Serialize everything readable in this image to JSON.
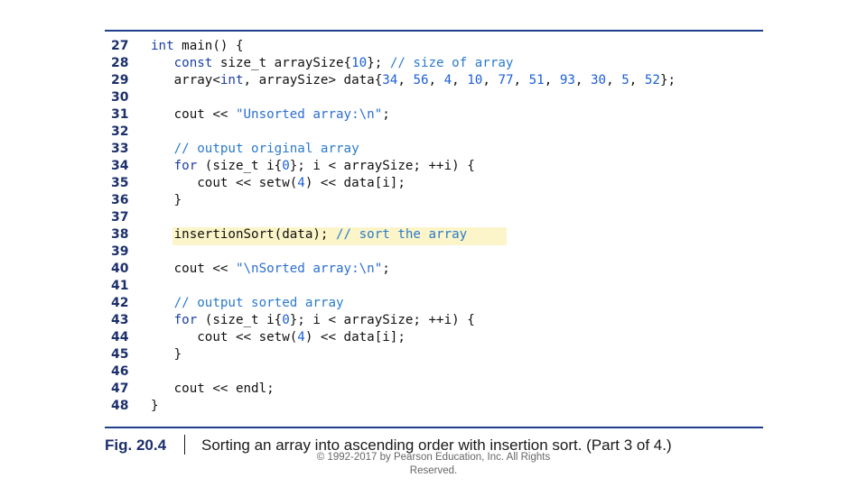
{
  "code_lines": [
    {
      "no": "27",
      "tokens": [
        {
          "t": "kw",
          "v": "int"
        },
        {
          "t": "p",
          "v": " main() {"
        }
      ]
    },
    {
      "no": "28",
      "tokens": [
        {
          "t": "p",
          "v": "   "
        },
        {
          "t": "kw",
          "v": "const"
        },
        {
          "t": "p",
          "v": " size_t arraySize{"
        },
        {
          "t": "num",
          "v": "10"
        },
        {
          "t": "p",
          "v": "}; "
        },
        {
          "t": "cmt",
          "v": "// size of array"
        }
      ]
    },
    {
      "no": "29",
      "tokens": [
        {
          "t": "p",
          "v": "   array<"
        },
        {
          "t": "kw",
          "v": "int"
        },
        {
          "t": "p",
          "v": ", arraySize> data{"
        },
        {
          "t": "num",
          "v": "34"
        },
        {
          "t": "p",
          "v": ", "
        },
        {
          "t": "num",
          "v": "56"
        },
        {
          "t": "p",
          "v": ", "
        },
        {
          "t": "num",
          "v": "4"
        },
        {
          "t": "p",
          "v": ", "
        },
        {
          "t": "num",
          "v": "10"
        },
        {
          "t": "p",
          "v": ", "
        },
        {
          "t": "num",
          "v": "77"
        },
        {
          "t": "p",
          "v": ", "
        },
        {
          "t": "num",
          "v": "51"
        },
        {
          "t": "p",
          "v": ", "
        },
        {
          "t": "num",
          "v": "93"
        },
        {
          "t": "p",
          "v": ", "
        },
        {
          "t": "num",
          "v": "30"
        },
        {
          "t": "p",
          "v": ", "
        },
        {
          "t": "num",
          "v": "5"
        },
        {
          "t": "p",
          "v": ", "
        },
        {
          "t": "num",
          "v": "52"
        },
        {
          "t": "p",
          "v": "};"
        }
      ]
    },
    {
      "no": "30",
      "tokens": []
    },
    {
      "no": "31",
      "tokens": [
        {
          "t": "p",
          "v": "   cout << "
        },
        {
          "t": "str",
          "v": "\"Unsorted array:\\n\""
        },
        {
          "t": "p",
          "v": ";"
        }
      ]
    },
    {
      "no": "32",
      "tokens": []
    },
    {
      "no": "33",
      "tokens": [
        {
          "t": "p",
          "v": "   "
        },
        {
          "t": "cmt",
          "v": "// output original array"
        }
      ]
    },
    {
      "no": "34",
      "tokens": [
        {
          "t": "p",
          "v": "   "
        },
        {
          "t": "kw",
          "v": "for"
        },
        {
          "t": "p",
          "v": " (size_t i{"
        },
        {
          "t": "num",
          "v": "0"
        },
        {
          "t": "p",
          "v": "}; i < arraySize; ++i) {"
        }
      ]
    },
    {
      "no": "35",
      "tokens": [
        {
          "t": "p",
          "v": "      cout << setw("
        },
        {
          "t": "num",
          "v": "4"
        },
        {
          "t": "p",
          "v": ") << data[i];"
        }
      ]
    },
    {
      "no": "36",
      "tokens": [
        {
          "t": "p",
          "v": "   }"
        }
      ]
    },
    {
      "no": "37",
      "tokens": []
    },
    {
      "no": "38",
      "tokens": [
        {
          "t": "p",
          "v": "   insertionSort(data); "
        },
        {
          "t": "cmt",
          "v": "// sort the array"
        }
      ]
    },
    {
      "no": "39",
      "tokens": []
    },
    {
      "no": "40",
      "tokens": [
        {
          "t": "p",
          "v": "   cout << "
        },
        {
          "t": "str",
          "v": "\"\\nSorted array:\\n\""
        },
        {
          "t": "p",
          "v": ";"
        }
      ]
    },
    {
      "no": "41",
      "tokens": []
    },
    {
      "no": "42",
      "tokens": [
        {
          "t": "p",
          "v": "   "
        },
        {
          "t": "cmt",
          "v": "// output sorted array"
        }
      ]
    },
    {
      "no": "43",
      "tokens": [
        {
          "t": "p",
          "v": "   "
        },
        {
          "t": "kw",
          "v": "for"
        },
        {
          "t": "p",
          "v": " (size_t i{"
        },
        {
          "t": "num",
          "v": "0"
        },
        {
          "t": "p",
          "v": "}; i < arraySize; ++i) {"
        }
      ]
    },
    {
      "no": "44",
      "tokens": [
        {
          "t": "p",
          "v": "      cout << setw("
        },
        {
          "t": "num",
          "v": "4"
        },
        {
          "t": "p",
          "v": ") << data[i];"
        }
      ]
    },
    {
      "no": "45",
      "tokens": [
        {
          "t": "p",
          "v": "   }"
        }
      ]
    },
    {
      "no": "46",
      "tokens": []
    },
    {
      "no": "47",
      "tokens": [
        {
          "t": "p",
          "v": "   cout << endl;"
        }
      ]
    },
    {
      "no": "48",
      "tokens": [
        {
          "t": "p",
          "v": "}"
        }
      ]
    }
  ],
  "highlighted_line": "38",
  "caption": {
    "label": "Fig. 20.4",
    "text": "Sorting an array into ascending order with insertion sort. (Part 3 of 4.)"
  },
  "copyright": {
    "line1": "© 1992-2017 by Pearson Education, Inc. All Rights",
    "line2": "Reserved."
  }
}
